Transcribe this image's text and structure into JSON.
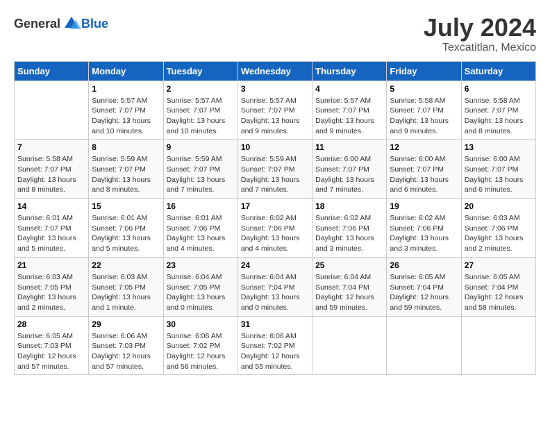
{
  "header": {
    "logo_general": "General",
    "logo_blue": "Blue",
    "month_year": "July 2024",
    "location": "Texcatitlan, Mexico"
  },
  "days_of_week": [
    "Sunday",
    "Monday",
    "Tuesday",
    "Wednesday",
    "Thursday",
    "Friday",
    "Saturday"
  ],
  "weeks": [
    [
      {
        "day": "",
        "info": ""
      },
      {
        "day": "1",
        "info": "Sunrise: 5:57 AM\nSunset: 7:07 PM\nDaylight: 13 hours\nand 10 minutes."
      },
      {
        "day": "2",
        "info": "Sunrise: 5:57 AM\nSunset: 7:07 PM\nDaylight: 13 hours\nand 10 minutes."
      },
      {
        "day": "3",
        "info": "Sunrise: 5:57 AM\nSunset: 7:07 PM\nDaylight: 13 hours\nand 9 minutes."
      },
      {
        "day": "4",
        "info": "Sunrise: 5:57 AM\nSunset: 7:07 PM\nDaylight: 13 hours\nand 9 minutes."
      },
      {
        "day": "5",
        "info": "Sunrise: 5:58 AM\nSunset: 7:07 PM\nDaylight: 13 hours\nand 9 minutes."
      },
      {
        "day": "6",
        "info": "Sunrise: 5:58 AM\nSunset: 7:07 PM\nDaylight: 13 hours\nand 8 minutes."
      }
    ],
    [
      {
        "day": "7",
        "info": "Sunrise: 5:58 AM\nSunset: 7:07 PM\nDaylight: 13 hours\nand 8 minutes."
      },
      {
        "day": "8",
        "info": "Sunrise: 5:59 AM\nSunset: 7:07 PM\nDaylight: 13 hours\nand 8 minutes."
      },
      {
        "day": "9",
        "info": "Sunrise: 5:59 AM\nSunset: 7:07 PM\nDaylight: 13 hours\nand 7 minutes."
      },
      {
        "day": "10",
        "info": "Sunrise: 5:59 AM\nSunset: 7:07 PM\nDaylight: 13 hours\nand 7 minutes."
      },
      {
        "day": "11",
        "info": "Sunrise: 6:00 AM\nSunset: 7:07 PM\nDaylight: 13 hours\nand 7 minutes."
      },
      {
        "day": "12",
        "info": "Sunrise: 6:00 AM\nSunset: 7:07 PM\nDaylight: 13 hours\nand 6 minutes."
      },
      {
        "day": "13",
        "info": "Sunrise: 6:00 AM\nSunset: 7:07 PM\nDaylight: 13 hours\nand 6 minutes."
      }
    ],
    [
      {
        "day": "14",
        "info": "Sunrise: 6:01 AM\nSunset: 7:07 PM\nDaylight: 13 hours\nand 5 minutes."
      },
      {
        "day": "15",
        "info": "Sunrise: 6:01 AM\nSunset: 7:06 PM\nDaylight: 13 hours\nand 5 minutes."
      },
      {
        "day": "16",
        "info": "Sunrise: 6:01 AM\nSunset: 7:06 PM\nDaylight: 13 hours\nand 4 minutes."
      },
      {
        "day": "17",
        "info": "Sunrise: 6:02 AM\nSunset: 7:06 PM\nDaylight: 13 hours\nand 4 minutes."
      },
      {
        "day": "18",
        "info": "Sunrise: 6:02 AM\nSunset: 7:06 PM\nDaylight: 13 hours\nand 3 minutes."
      },
      {
        "day": "19",
        "info": "Sunrise: 6:02 AM\nSunset: 7:06 PM\nDaylight: 13 hours\nand 3 minutes."
      },
      {
        "day": "20",
        "info": "Sunrise: 6:03 AM\nSunset: 7:06 PM\nDaylight: 13 hours\nand 2 minutes."
      }
    ],
    [
      {
        "day": "21",
        "info": "Sunrise: 6:03 AM\nSunset: 7:05 PM\nDaylight: 13 hours\nand 2 minutes."
      },
      {
        "day": "22",
        "info": "Sunrise: 6:03 AM\nSunset: 7:05 PM\nDaylight: 13 hours\nand 1 minute."
      },
      {
        "day": "23",
        "info": "Sunrise: 6:04 AM\nSunset: 7:05 PM\nDaylight: 13 hours\nand 0 minutes."
      },
      {
        "day": "24",
        "info": "Sunrise: 6:04 AM\nSunset: 7:04 PM\nDaylight: 13 hours\nand 0 minutes."
      },
      {
        "day": "25",
        "info": "Sunrise: 6:04 AM\nSunset: 7:04 PM\nDaylight: 12 hours\nand 59 minutes."
      },
      {
        "day": "26",
        "info": "Sunrise: 6:05 AM\nSunset: 7:04 PM\nDaylight: 12 hours\nand 59 minutes."
      },
      {
        "day": "27",
        "info": "Sunrise: 6:05 AM\nSunset: 7:04 PM\nDaylight: 12 hours\nand 58 minutes."
      }
    ],
    [
      {
        "day": "28",
        "info": "Sunrise: 6:05 AM\nSunset: 7:03 PM\nDaylight: 12 hours\nand 57 minutes."
      },
      {
        "day": "29",
        "info": "Sunrise: 6:06 AM\nSunset: 7:03 PM\nDaylight: 12 hours\nand 57 minutes."
      },
      {
        "day": "30",
        "info": "Sunrise: 6:06 AM\nSunset: 7:02 PM\nDaylight: 12 hours\nand 56 minutes."
      },
      {
        "day": "31",
        "info": "Sunrise: 6:06 AM\nSunset: 7:02 PM\nDaylight: 12 hours\nand 55 minutes."
      },
      {
        "day": "",
        "info": ""
      },
      {
        "day": "",
        "info": ""
      },
      {
        "day": "",
        "info": ""
      }
    ]
  ]
}
